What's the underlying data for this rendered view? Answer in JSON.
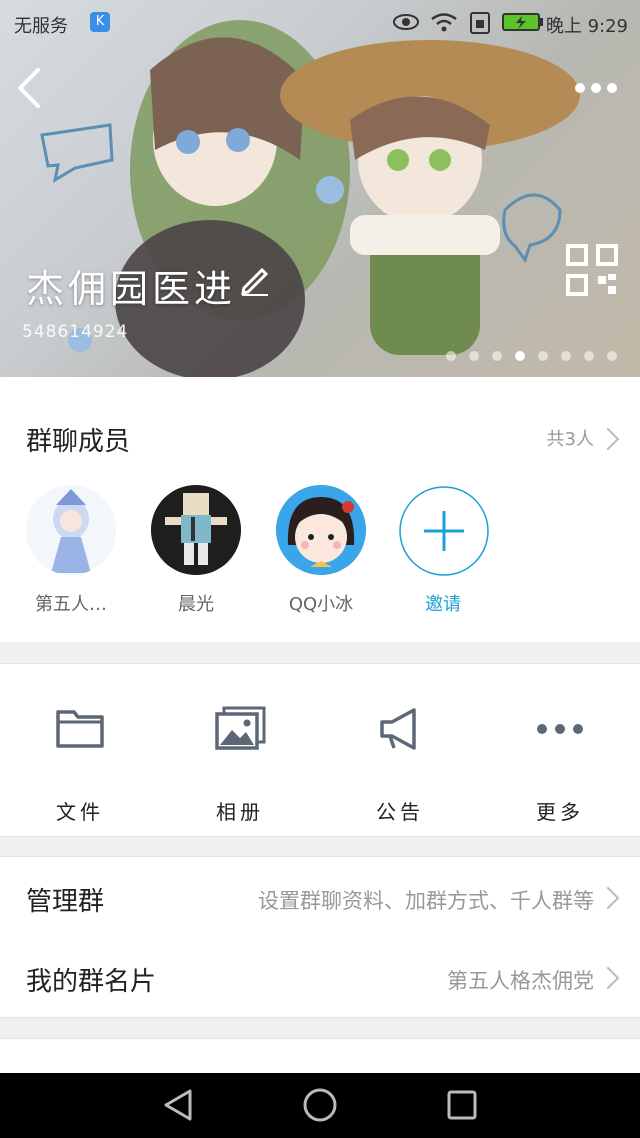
{
  "status_bar": {
    "carrier": "无服务",
    "k_badge": "K",
    "time": "晚上 9:29"
  },
  "header": {
    "group_name": "杰佣园医进",
    "group_id": "548614924",
    "page_dots": 8,
    "active_dot": 3
  },
  "members": {
    "title": "群聊成员",
    "count": "共3人",
    "list": [
      {
        "label": "第五人…"
      },
      {
        "label": "晨光"
      },
      {
        "label": "QQ小冰"
      }
    ],
    "invite_label": "邀请",
    "invite_color": "#1aa1d6"
  },
  "tools": [
    {
      "label": "文件",
      "icon": "folder-icon"
    },
    {
      "label": "相册",
      "icon": "album-icon"
    },
    {
      "label": "公告",
      "icon": "megaphone-icon"
    },
    {
      "label": "更多",
      "icon": "more-dots-icon"
    }
  ],
  "rows": {
    "manage": {
      "title": "管理群",
      "value": "设置群聊资料、加群方式、千人群等"
    },
    "card": {
      "title": "我的群名片",
      "value": "第五人格杰佣党"
    }
  }
}
